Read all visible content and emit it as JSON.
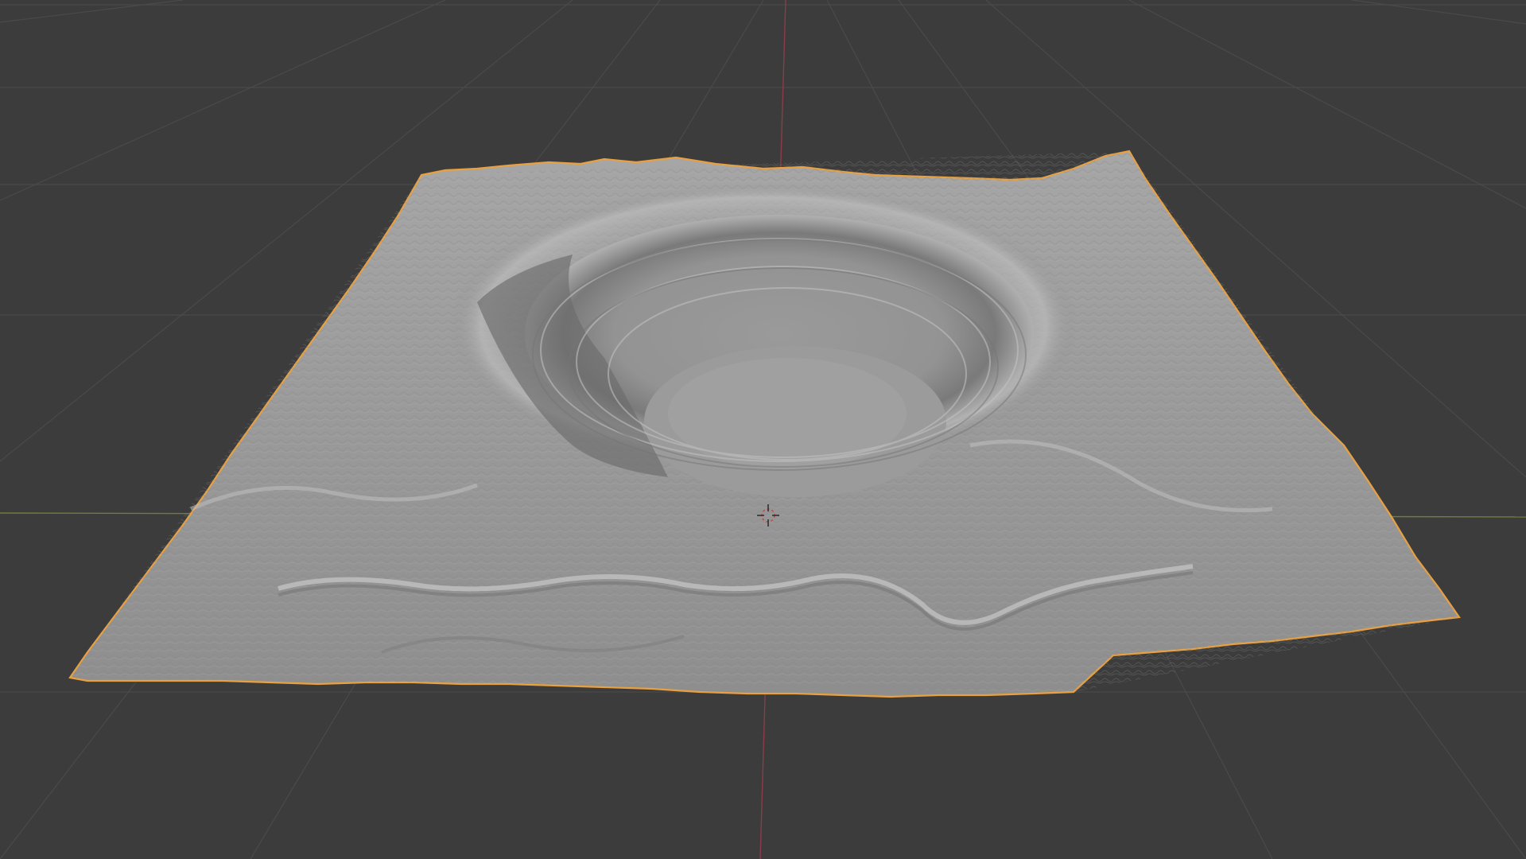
{
  "viewport": {
    "background": "#3c3c3c",
    "grid_color": "#4a4a4a",
    "x_axis_color": "#7a8a3c",
    "y_axis_color": "#8a3c4a",
    "selection_outline_color": "#e8a040",
    "mesh_base_color": "#9c9c9c",
    "object": "terrain-mesh",
    "object_selected": true,
    "shading": "solid",
    "icons": [
      "3d-cursor-icon"
    ]
  }
}
